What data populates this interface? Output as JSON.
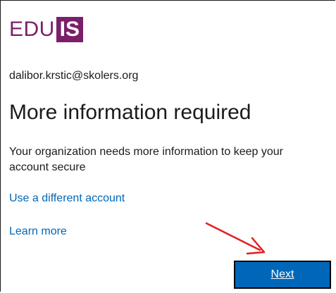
{
  "logo": {
    "text": "EDU",
    "badge_text": "IS",
    "brand_color": "#7b1f6a"
  },
  "account": {
    "email": "dalibor.krstic@skolers.org"
  },
  "main": {
    "title": "More information required",
    "description": "Your organization needs more information to keep your account secure",
    "use_different_account_label": "Use a different account",
    "learn_more_label": "Learn more"
  },
  "actions": {
    "next_label": "Next"
  },
  "colors": {
    "link": "#0067b8",
    "button": "#0067b8",
    "annotation_arrow": "#e02020"
  }
}
